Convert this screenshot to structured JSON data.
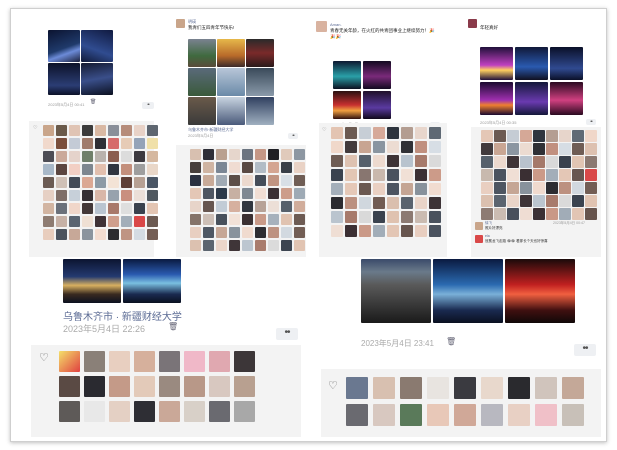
{
  "posts": {
    "p1": {
      "time": "2023年5月4日 00:41",
      "dots": "••"
    },
    "p2": {
      "author": "明瑛",
      "text": "我青们五四青年节快乐!",
      "location": "乌鲁木齐市·新疆财经大学",
      "time": "2023年5月4日",
      "dots": "••"
    },
    "p3": {
      "author": "Aman.",
      "text": "青春无关年龄，在火红的共青团事业上继续努力！🎉🎉🎉",
      "time": "2023年5月4日 17:02",
      "dots": "••"
    },
    "p4": {
      "author": "",
      "text": "年轻真好",
      "time": "2023年5月4日 00:35",
      "dots": "••",
      "comments": [
        {
          "name": "徐飞",
          "text": "照片好漂亮",
          "time": "2023年5月4日 00:47"
        },
        {
          "name": "ela",
          "text": "冠冕龙飞走路 😂😂 看那长个天也好惊喜",
          "time": ""
        }
      ]
    },
    "p5": {
      "location": "乌鲁木齐市 · 新疆财经大学",
      "time": "2023年5月4日 22:26",
      "dots": "••"
    },
    "p6": {
      "time": "2023年5月4日 23:41",
      "dots": "••"
    }
  },
  "icons": {
    "heart": "heart-icon",
    "delete": "trash-icon",
    "more": "more-dots-icon"
  },
  "colors": {
    "author": "#5b6b94",
    "meta": "#999999",
    "likes_bg": "#f3f3f3"
  }
}
